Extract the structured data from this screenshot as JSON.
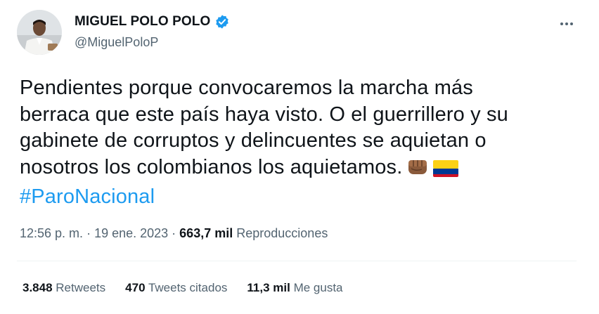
{
  "author": {
    "name": "MIGUEL POLO POLO",
    "handle": "@MiguelPoloP",
    "verified_color": "#1d9bf0"
  },
  "tweet": {
    "lines": [
      "Pendientes porque convocaremos la marcha más",
      "berraca que este país haya visto. O el guerrillero y su",
      "gabinete de corruptos y delincuentes se aquietan o",
      "nosotros los colombianos los aquietamos."
    ],
    "hashtag": "#ParoNacional",
    "emojis": [
      "fist-icon",
      "colombia-flag-icon"
    ]
  },
  "meta": {
    "time": "12:56 p. m.",
    "sep1": " · ",
    "date": "19 ene. 2023",
    "sep2": " · ",
    "views_count": "663,7 mil",
    "views_label": "Reproducciones"
  },
  "stats": {
    "retweets_count": "3.848",
    "retweets_label": "Retweets",
    "quotes_count": "470",
    "quotes_label": "Tweets citados",
    "likes_count": "11,3 mil",
    "likes_label": "Me gusta"
  },
  "colors": {
    "accent": "#1d9bf0",
    "text": "#0f1419",
    "secondary": "#536471"
  }
}
